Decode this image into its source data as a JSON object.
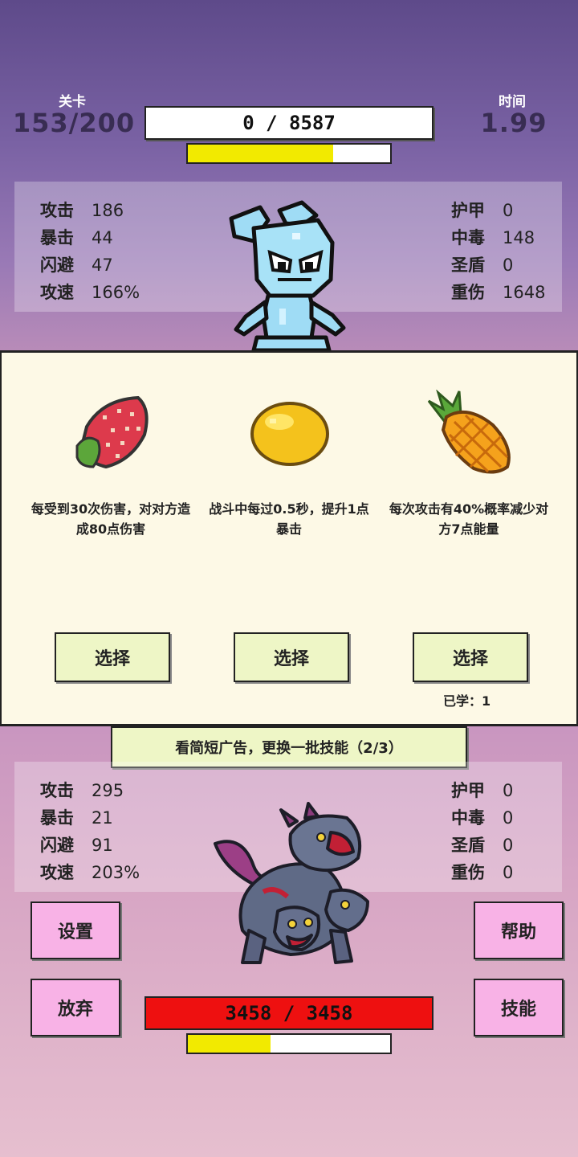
{
  "hud": {
    "level_label": "关卡",
    "level_value": "153/200",
    "time_label": "时间",
    "time_value": "1.99",
    "player_hp": "0 / 8587",
    "player_energy_fraction": 0.72
  },
  "player_stats": {
    "left": [
      {
        "label": "攻击",
        "value": "186"
      },
      {
        "label": "暴击",
        "value": "44"
      },
      {
        "label": "闪避",
        "value": "47"
      },
      {
        "label": "攻速",
        "value": "166%"
      }
    ],
    "right": [
      {
        "label": "护甲",
        "value": "0"
      },
      {
        "label": "中毒",
        "value": "148"
      },
      {
        "label": "圣盾",
        "value": "0"
      },
      {
        "label": "重伤",
        "value": "1648"
      }
    ]
  },
  "skills": [
    {
      "icon": "strawberry-icon",
      "desc": "每受到30次伤害，对对方造成80点伤害",
      "button": "选择",
      "learned": ""
    },
    {
      "icon": "lemon-icon",
      "desc": "战斗中每过0.5秒，提升1点暴击",
      "button": "选择",
      "learned": ""
    },
    {
      "icon": "pineapple-icon",
      "desc": "每次攻击有40%概率减少对方7点能量",
      "button": "选择",
      "learned": "已学：1"
    }
  ],
  "ad_button": "看简短广告，更换一批技能（2/3）",
  "enemy_stats": {
    "left": [
      {
        "label": "攻击",
        "value": "295"
      },
      {
        "label": "暴击",
        "value": "21"
      },
      {
        "label": "闪避",
        "value": "91"
      },
      {
        "label": "攻速",
        "value": "203%"
      }
    ],
    "right": [
      {
        "label": "护甲",
        "value": "0"
      },
      {
        "label": "中毒",
        "value": "0"
      },
      {
        "label": "圣盾",
        "value": "0"
      },
      {
        "label": "重伤",
        "value": "0"
      }
    ]
  },
  "buttons": {
    "settings": "设置",
    "help": "帮助",
    "give_up": "放弃",
    "skills": "技能"
  },
  "enemy": {
    "hp": "3458 / 3458",
    "energy_fraction": 0.41
  },
  "colors": {
    "energy": "#f2ea00",
    "enemy_hp": "#ee1010",
    "button_pink": "#f8b2e6",
    "button_green": "#eef6c6"
  }
}
